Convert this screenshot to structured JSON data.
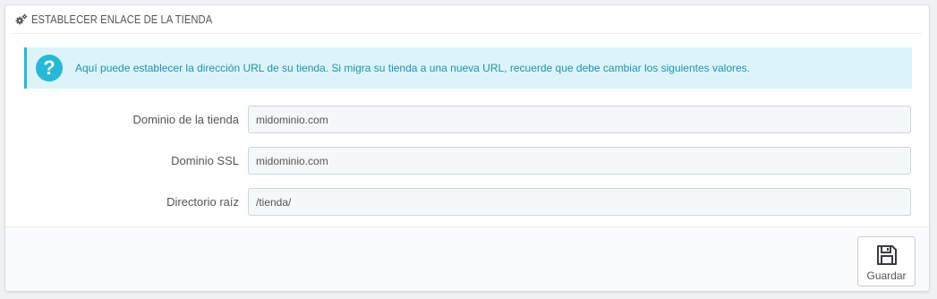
{
  "panel": {
    "title": "ESTABLECER ENLACE DE LA TIENDA",
    "title_icon": "gears-icon"
  },
  "alert": {
    "icon": "question-icon",
    "icon_glyph": "?",
    "text": "Aquí puede establecer la dirección URL de su tienda. Si migra su tienda a una nueva URL, recuerde que debe cambiar los siguientes valores."
  },
  "form": {
    "fields": [
      {
        "label": "Dominio de la tienda",
        "value": "midominio.com"
      },
      {
        "label": "Dominio SSL",
        "value": "midominio.com"
      },
      {
        "label": "Directorio raíz",
        "value": "/tienda/"
      }
    ]
  },
  "footer": {
    "save_label": "Guardar",
    "save_icon": "floppy-disk-icon"
  },
  "colors": {
    "accent": "#25b9d7",
    "alert_bg": "#dcf4f9",
    "alert_text": "#1e94ab",
    "input_bg": "#f5f8f9",
    "page_bg": "#eff1f2"
  }
}
